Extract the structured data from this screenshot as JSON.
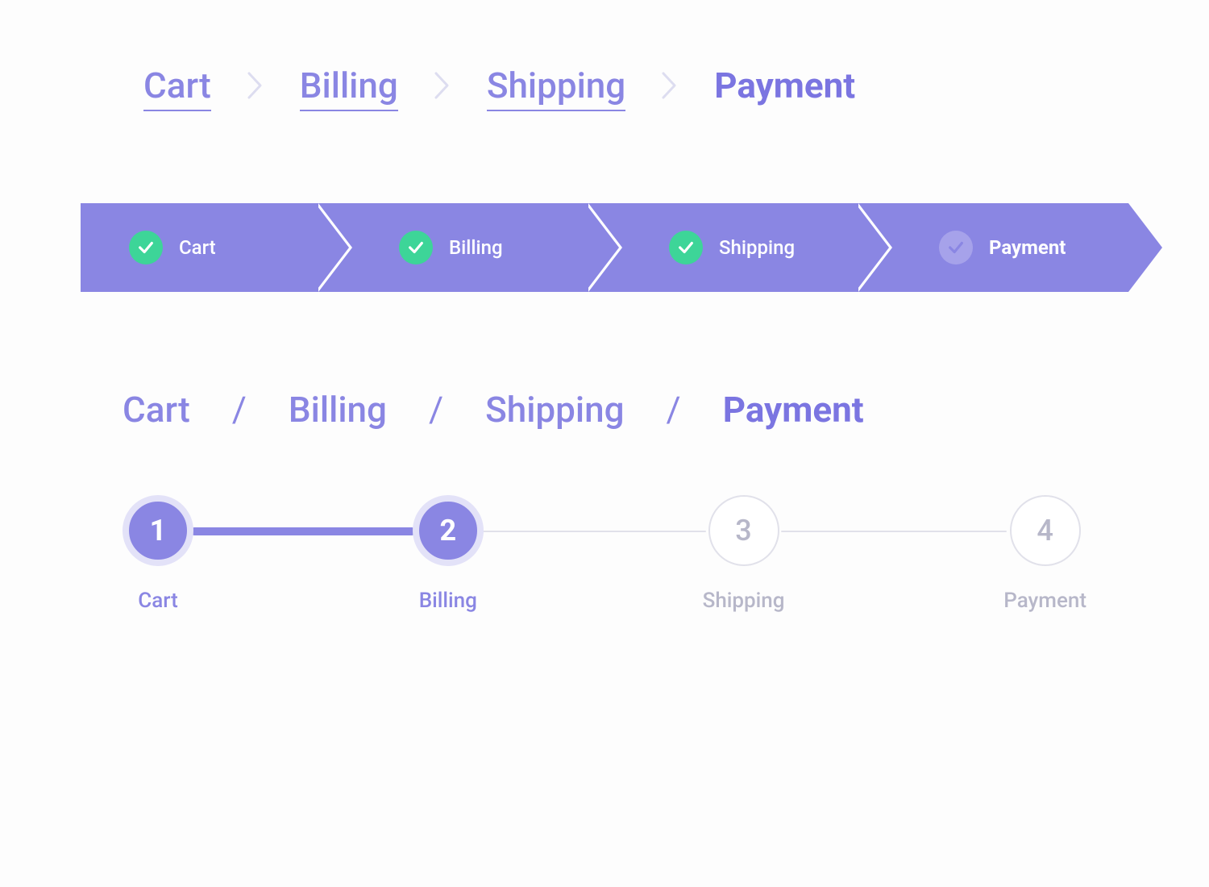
{
  "colors": {
    "accent": "#8a86e3",
    "accent_dark": "#7b75e1",
    "success": "#3dd598",
    "muted": "#b7b7c9",
    "ring": "#e3e2f8",
    "outline": "#e1e1ea"
  },
  "steps": [
    "Cart",
    "Billing",
    "Shipping",
    "Payment"
  ],
  "variant1": {
    "items": [
      {
        "label": "Cart",
        "completed": true,
        "current": false
      },
      {
        "label": "Billing",
        "completed": true,
        "current": false
      },
      {
        "label": "Shipping",
        "completed": true,
        "current": false
      },
      {
        "label": "Payment",
        "completed": false,
        "current": true
      }
    ]
  },
  "variant2": {
    "items": [
      {
        "label": "Cart",
        "status": "done",
        "current": false
      },
      {
        "label": "Billing",
        "status": "done",
        "current": false
      },
      {
        "label": "Shipping",
        "status": "done",
        "current": false
      },
      {
        "label": "Payment",
        "status": "pending",
        "current": true
      }
    ]
  },
  "variant3": {
    "items": [
      {
        "label": "Cart",
        "current": false
      },
      {
        "label": "Billing",
        "current": false
      },
      {
        "label": "Shipping",
        "current": false
      },
      {
        "label": "Payment",
        "current": true
      }
    ]
  },
  "variant4": {
    "items": [
      {
        "number": "1",
        "label": "Cart",
        "state": "active"
      },
      {
        "number": "2",
        "label": "Billing",
        "state": "active"
      },
      {
        "number": "3",
        "label": "Shipping",
        "state": "inactive"
      },
      {
        "number": "4",
        "label": "Payment",
        "state": "inactive"
      }
    ],
    "active_up_to_index": 1
  }
}
